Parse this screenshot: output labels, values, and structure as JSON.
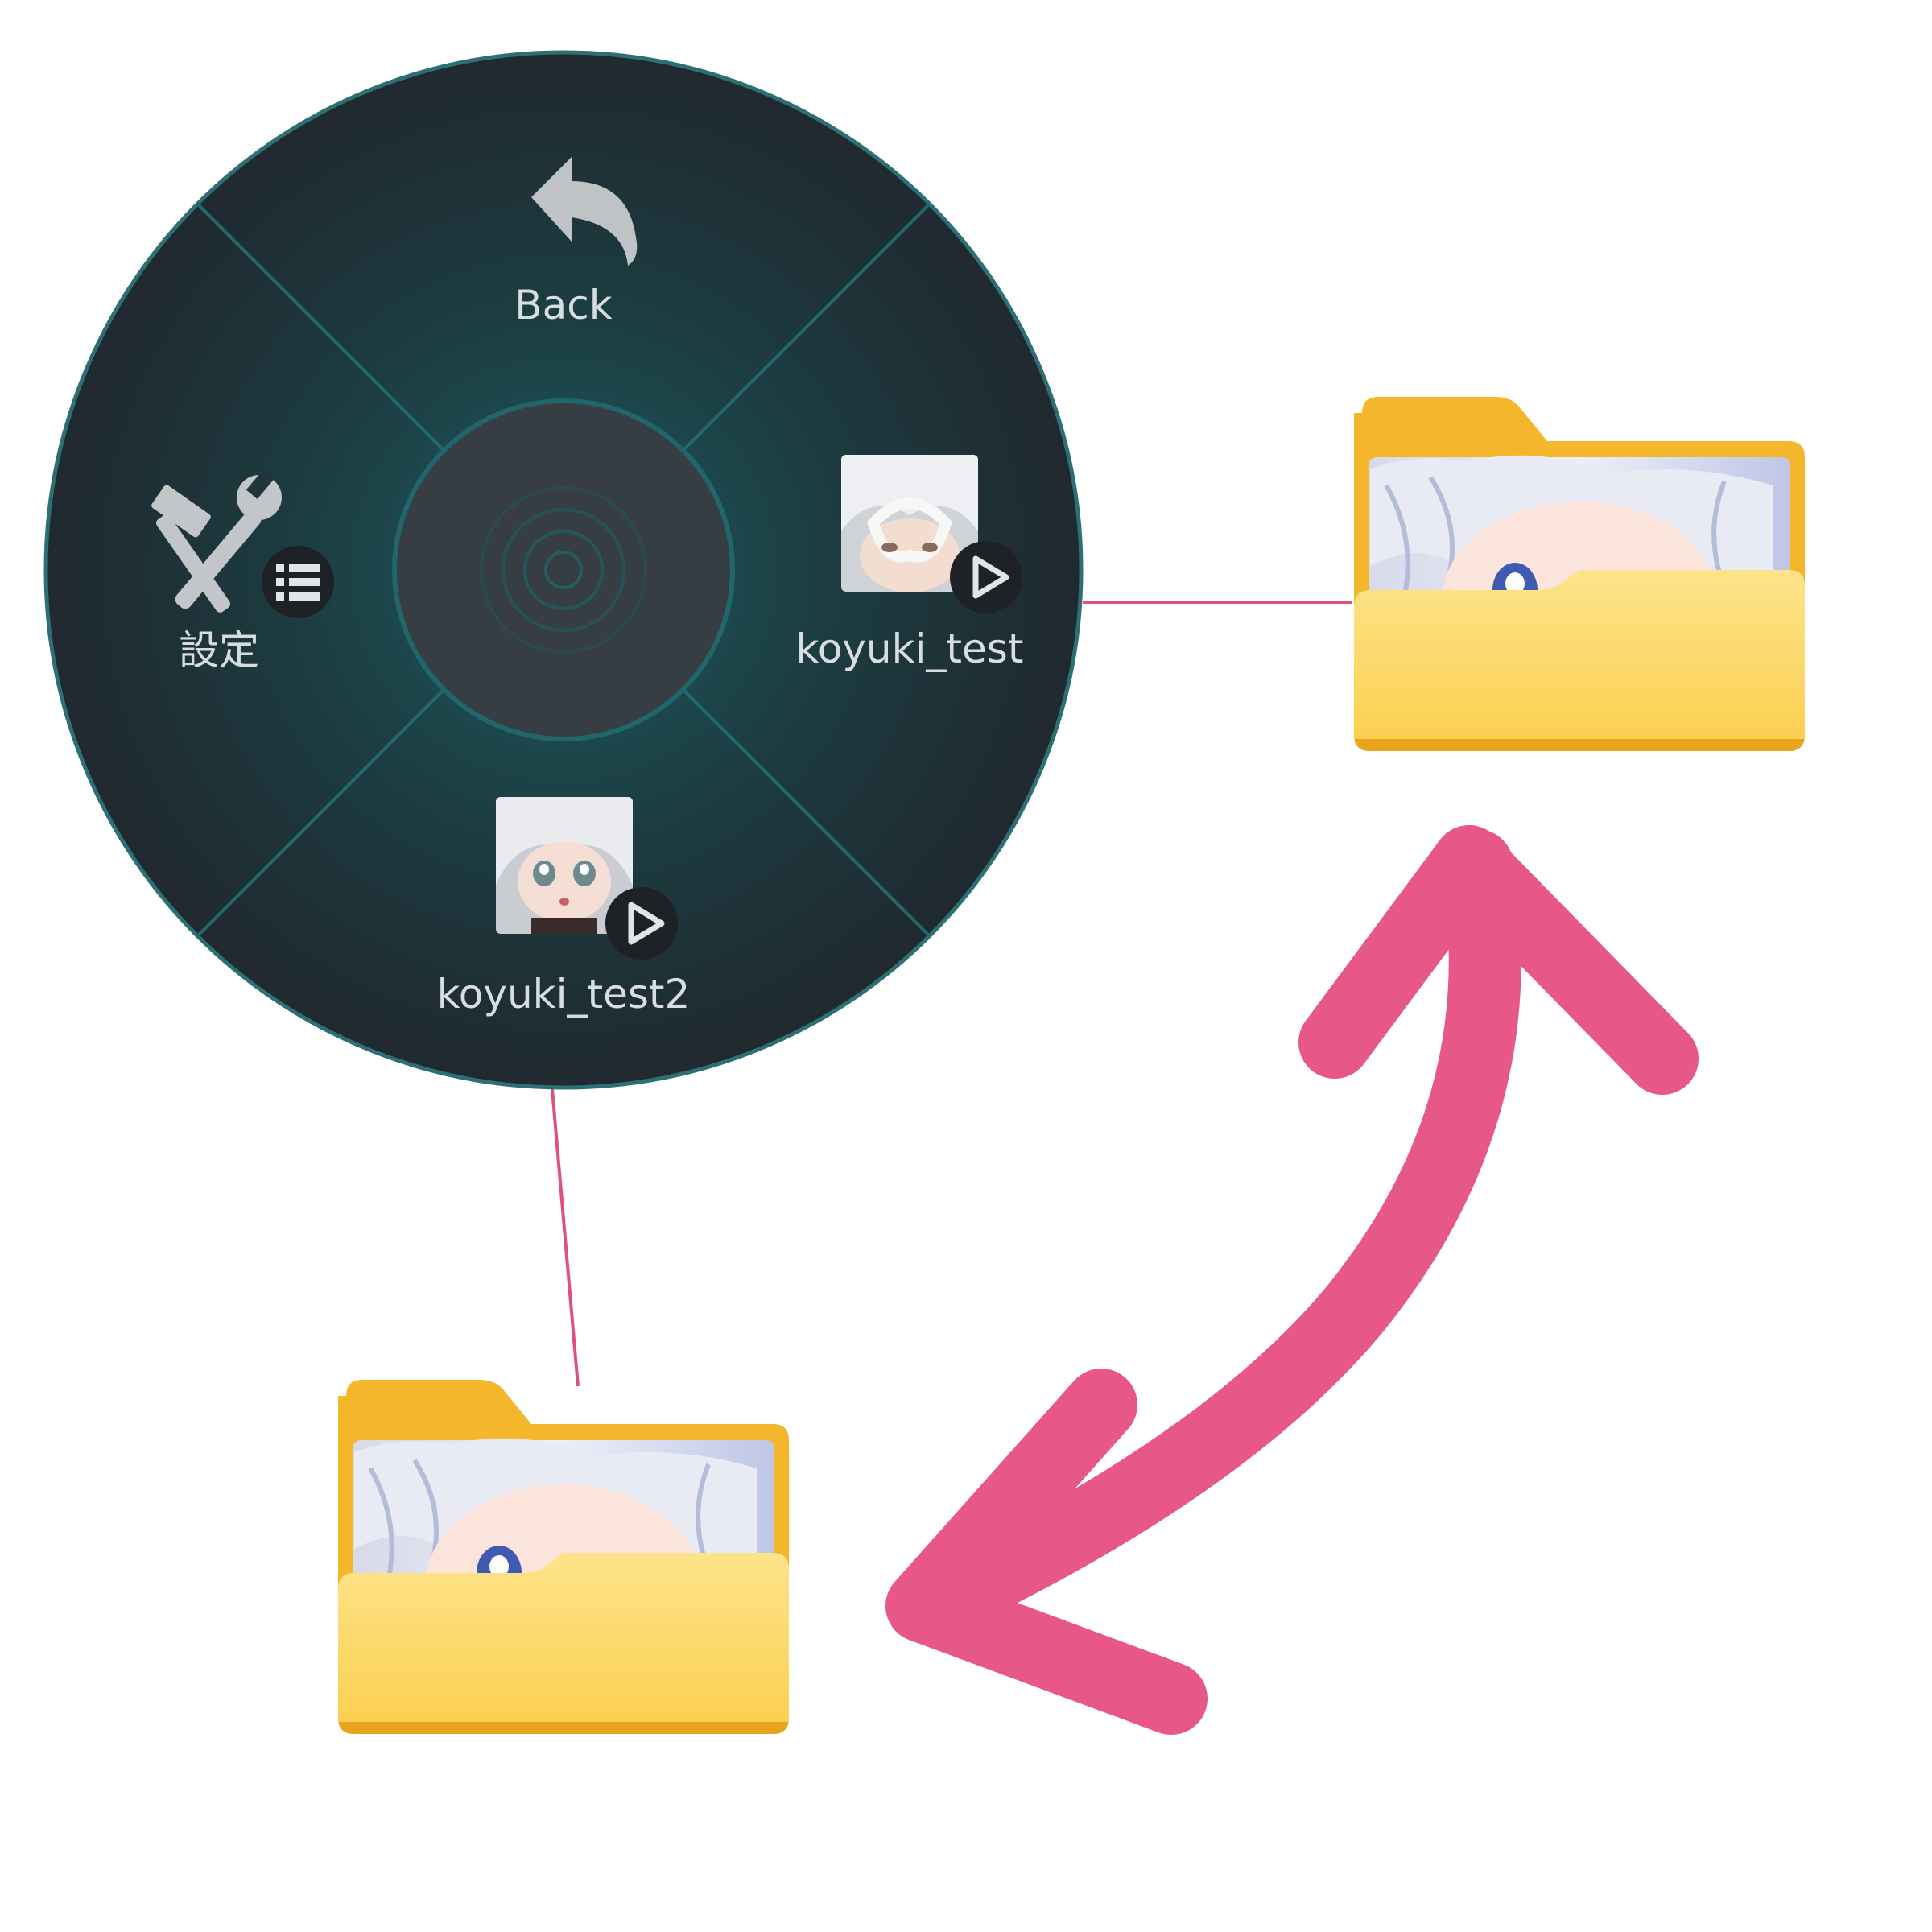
{
  "radial_menu": {
    "center_icon": "concentric-circles-icon",
    "items": {
      "back": {
        "label": "Back",
        "icon": "undo-arrow-icon"
      },
      "settings": {
        "label": "設定",
        "icon": "tools-icon",
        "badge_icon": "list-icon"
      },
      "toggle_1": {
        "label": "koyuki_test",
        "icon": "avatar-thumbnail",
        "badge_icon": "play-icon"
      },
      "toggle_2": {
        "label": "koyuki_test2",
        "icon": "avatar-thumbnail",
        "badge_icon": "play-icon"
      }
    }
  },
  "annotations": {
    "folder_icon": "folder-icon",
    "connector_color": "#e0507f",
    "arrow_icon": "double-headed-curved-arrow",
    "arrow_color": "#e75887"
  },
  "colors": {
    "menu_background": "#1e3438",
    "menu_accent": "#20666b",
    "center_disc": "#363e44",
    "folder_back": "#f4b62a",
    "folder_front": "#fdd86d"
  }
}
